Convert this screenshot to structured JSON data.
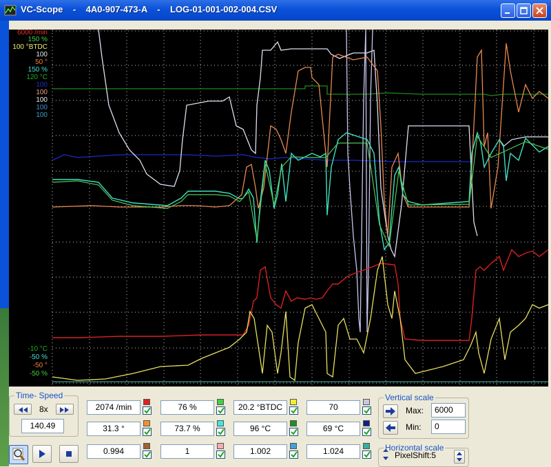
{
  "window": {
    "title": "VC-Scope    -    4A0-907-473-A    -    LOG-01-001-002-004.CSV"
  },
  "scope": {
    "background": "#000000",
    "axis_labels_top": [
      {
        "text": "6000 /min",
        "color": "#E03030"
      },
      {
        "text": "150 %",
        "color": "#40D040"
      },
      {
        "text": "100 °BTDC",
        "color": "#F0F070"
      },
      {
        "text": "100",
        "color": "#E8E8F0"
      },
      {
        "text": "50 °",
        "color": "#F08040"
      },
      {
        "text": "150 %",
        "color": "#40E0D0"
      },
      {
        "text": "120 °C",
        "color": "#20B020"
      },
      {
        "text": "100",
        "color": "#2030C0"
      },
      {
        "text": "100",
        "color": "#F0A080"
      },
      {
        "text": "100",
        "color": "#F0F0F0"
      },
      {
        "text": "100",
        "color": "#4090E0"
      },
      {
        "text": "100",
        "color": "#40A0C0"
      }
    ],
    "axis_labels_bottom": [
      {
        "text": "-10 °C",
        "color": "#20B020"
      },
      {
        "text": "-50 %",
        "color": "#40E0D0"
      },
      {
        "text": "-50 °",
        "color": "#F08040"
      },
      {
        "text": "-50 %",
        "color": "#40D040"
      }
    ]
  },
  "time_speed": {
    "title": "Time- Speed",
    "speed": "8x",
    "time": "140.49",
    "rewind_icon": "fast-rewind-icon",
    "forward_icon": "fast-forward-icon"
  },
  "playback": {
    "zoom_icon": "magnifier-icon",
    "play_icon": "play-icon",
    "stop_icon": "stop-icon"
  },
  "channels": [
    {
      "value": "2074 /min",
      "color": "#E02020"
    },
    {
      "value": "76 %",
      "color": "#40D040"
    },
    {
      "value": "20.2 °BTDC",
      "color": "#F0F030"
    },
    {
      "value": "70",
      "color": "#C8C8E0"
    },
    {
      "value": "31.3 °",
      "color": "#F09030"
    },
    {
      "value": "73.7 %",
      "color": "#40E8E0"
    },
    {
      "value": "96 °C",
      "color": "#209020"
    },
    {
      "value": "69 °C",
      "color": "#102080"
    },
    {
      "value": "0.994",
      "color": "#A06030"
    },
    {
      "value": "1",
      "color": "#F0B0B0"
    },
    {
      "value": "1.002",
      "color": "#40A0E0"
    },
    {
      "value": "1.024",
      "color": "#30B0A0"
    }
  ],
  "vertical_scale": {
    "title": "Vertical scale",
    "max_label": "Max:",
    "max_value": "6000",
    "min_label": "Min:",
    "min_value": "0"
  },
  "horizontal_scale": {
    "title": "Horizontal scale",
    "value": "PixelShift:5"
  }
}
